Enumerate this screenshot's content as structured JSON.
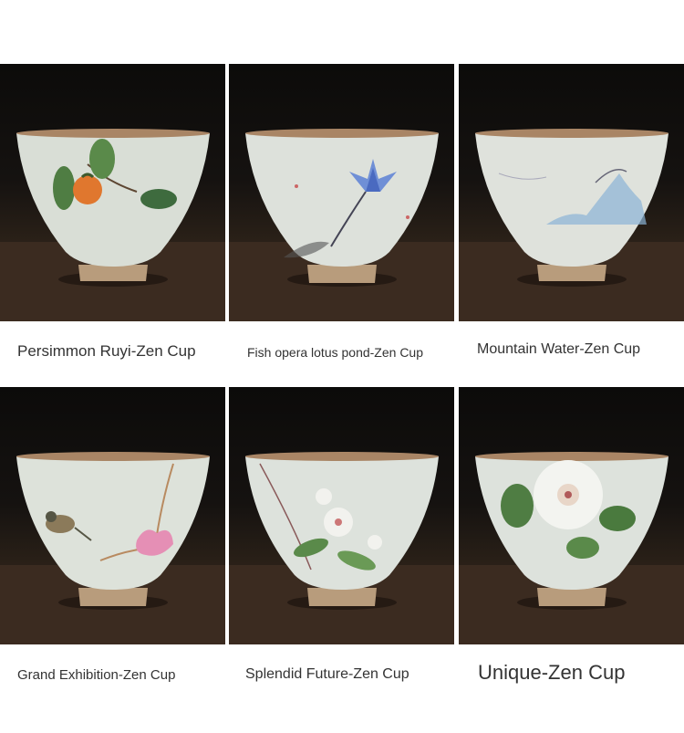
{
  "products": [
    {
      "name": "Persimmon Ruyi-Zen Cup",
      "motif": "persimmon"
    },
    {
      "name": "Fish opera lotus pond-Zen Cup",
      "motif": "lotus"
    },
    {
      "name": "Mountain Water-Zen Cup",
      "motif": "mountain"
    },
    {
      "name": "Grand Exhibition-Zen Cup",
      "motif": "bird-magnolia"
    },
    {
      "name": "Splendid Future-Zen Cup",
      "motif": "flower-branch"
    },
    {
      "name": "Unique-Zen Cup",
      "motif": "camellia"
    }
  ]
}
